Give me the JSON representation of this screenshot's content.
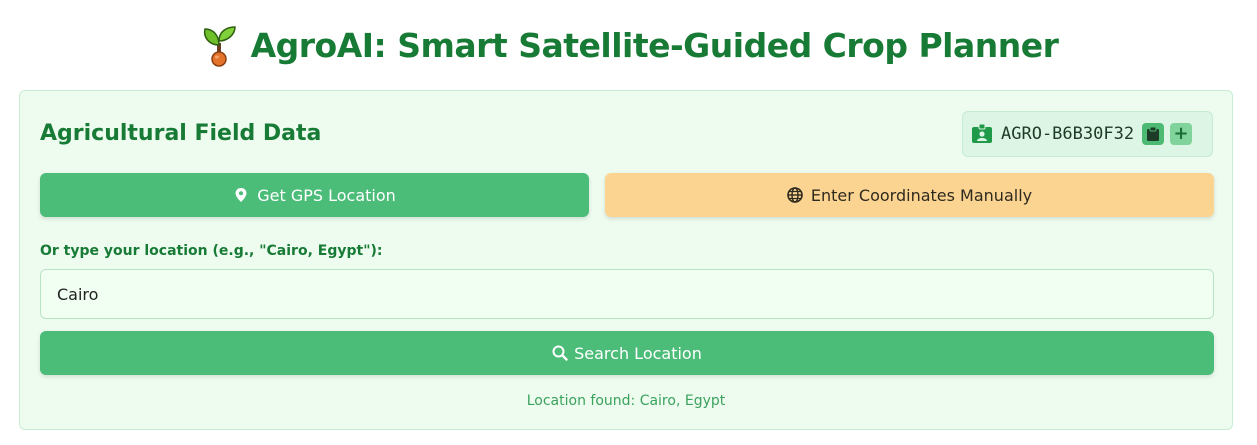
{
  "header": {
    "title": "AgroAI: Smart Satellite-Guided Crop Planner",
    "logo_icon": "seedling-icon"
  },
  "card": {
    "title": "Agricultural Field Data",
    "field_id": {
      "value": "AGRO-B6B30F32",
      "icon": "id-card-icon",
      "copy_icon": "clipboard-icon",
      "add_icon": "plus-icon"
    },
    "gps_button": {
      "label": "Get GPS Location",
      "icon": "map-pin-icon"
    },
    "manual_button": {
      "label": "Enter Coordinates Manually",
      "icon": "globe-icon"
    },
    "location_input": {
      "label": "Or type your location (e.g., \"Cairo, Egypt\"):",
      "value": "Cairo"
    },
    "search_button": {
      "label": "Search Location",
      "icon": "search-icon"
    },
    "status": "Location found: Cairo, Egypt"
  },
  "colors": {
    "brand_green": "#177a35",
    "button_green": "#4cbc79",
    "button_orange": "#fbd492",
    "card_bg": "#eefcf0",
    "status_green": "#3aa25d"
  }
}
